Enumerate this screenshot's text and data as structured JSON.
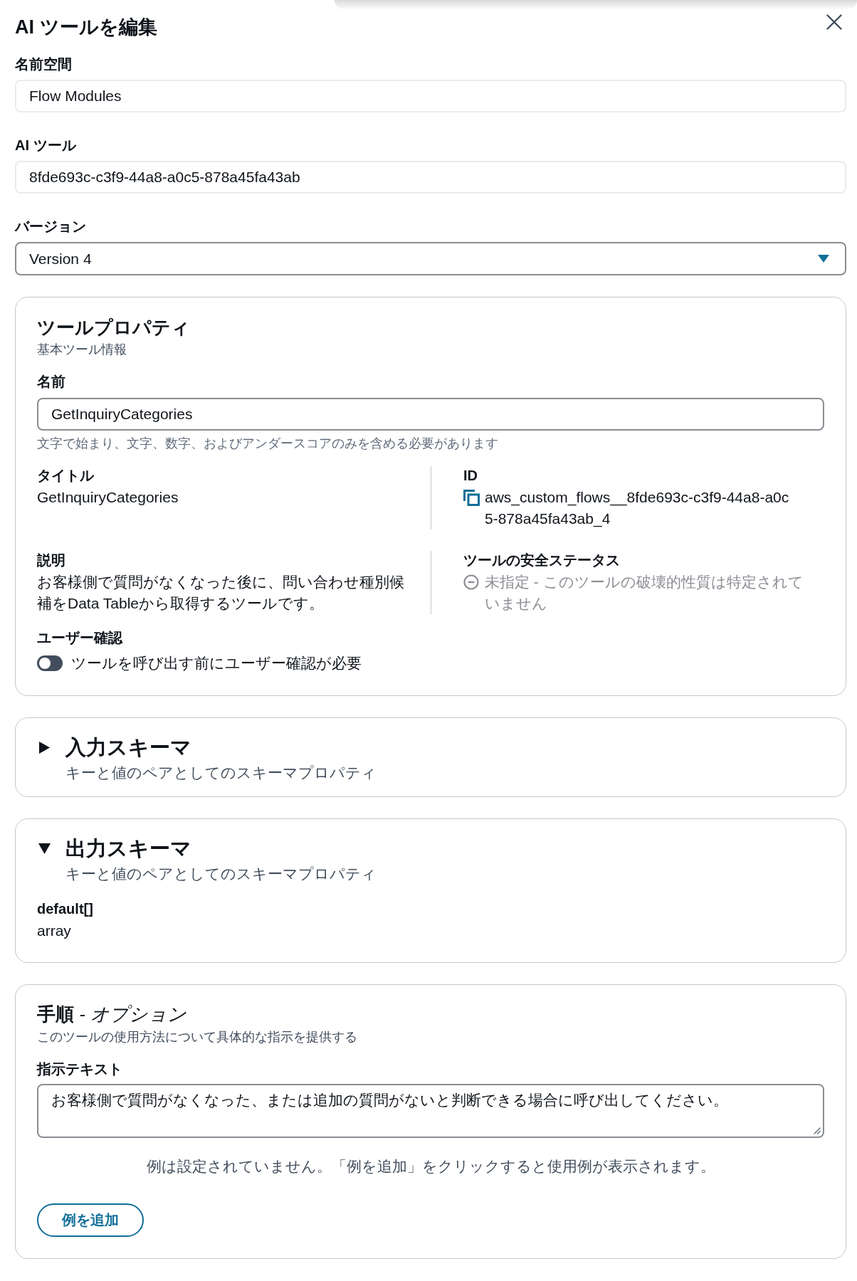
{
  "dialog": {
    "title": "AI ツールを編集"
  },
  "fields": [
    {
      "kind": "text",
      "label": "名前空間",
      "value": "Flow Modules",
      "disabled": true
    },
    {
      "kind": "text",
      "label": "AI ツール",
      "value": "8fde693c-c3f9-44a8-a0c5-878a45fa43ab",
      "disabled": true
    },
    {
      "kind": "select",
      "label": "バージョン",
      "value": "Version 4",
      "disabled": false
    }
  ],
  "tool_properties": {
    "heading": "ツールプロパティ",
    "description": "基本ツール情報",
    "name_field": {
      "label": "名前",
      "value": "GetInquiryCategories",
      "hint": "文字で始まり、文字、数字、およびアンダースコアのみを含める必要があります"
    },
    "details": [
      {
        "kind": "text",
        "label": "タイトル",
        "value": "GetInquiryCategories"
      },
      {
        "kind": "copyable",
        "label": "ID",
        "value": "aws_custom_flows__8fde693c-c3f9-44a8-a0c5-878a45fa43ab_4"
      },
      {
        "kind": "text",
        "label": "説明",
        "value": "お客様側で質問がなくなった後に、問い合わせ種別候補をData Tableから取得するツールです。"
      },
      {
        "kind": "status",
        "label": "ツールの安全ステータス",
        "value": "未指定 - このツールの破壊的性質は特定されていません"
      }
    ],
    "user_confirmation": {
      "label": "ユーザー確認",
      "toggle_label": "ツールを呼び出す前にユーザー確認が必要",
      "on": false
    }
  },
  "schemas": [
    {
      "heading": "入力スキーマ",
      "description": "キーと値のペアとしてのスキーマプロパティ",
      "expanded": false
    },
    {
      "heading": "出力スキーマ",
      "description": "キーと値のペアとしてのスキーマプロパティ",
      "expanded": true,
      "properties": [
        {
          "name": "default[]",
          "type": "array"
        }
      ]
    }
  ],
  "instructions": {
    "heading": "手順 *- オプション*",
    "description": "このツールの使用方法について具体的な指示を提供する",
    "field_label": "指示テキスト",
    "text": "お客様側で質問がなくなった、または追加の質問がないと判断できる場合に呼び出してください。",
    "empty_message": "例は設定されていません。「例を追加」をクリックすると使用例が表示されます。",
    "add_button": "例を追加"
  }
}
